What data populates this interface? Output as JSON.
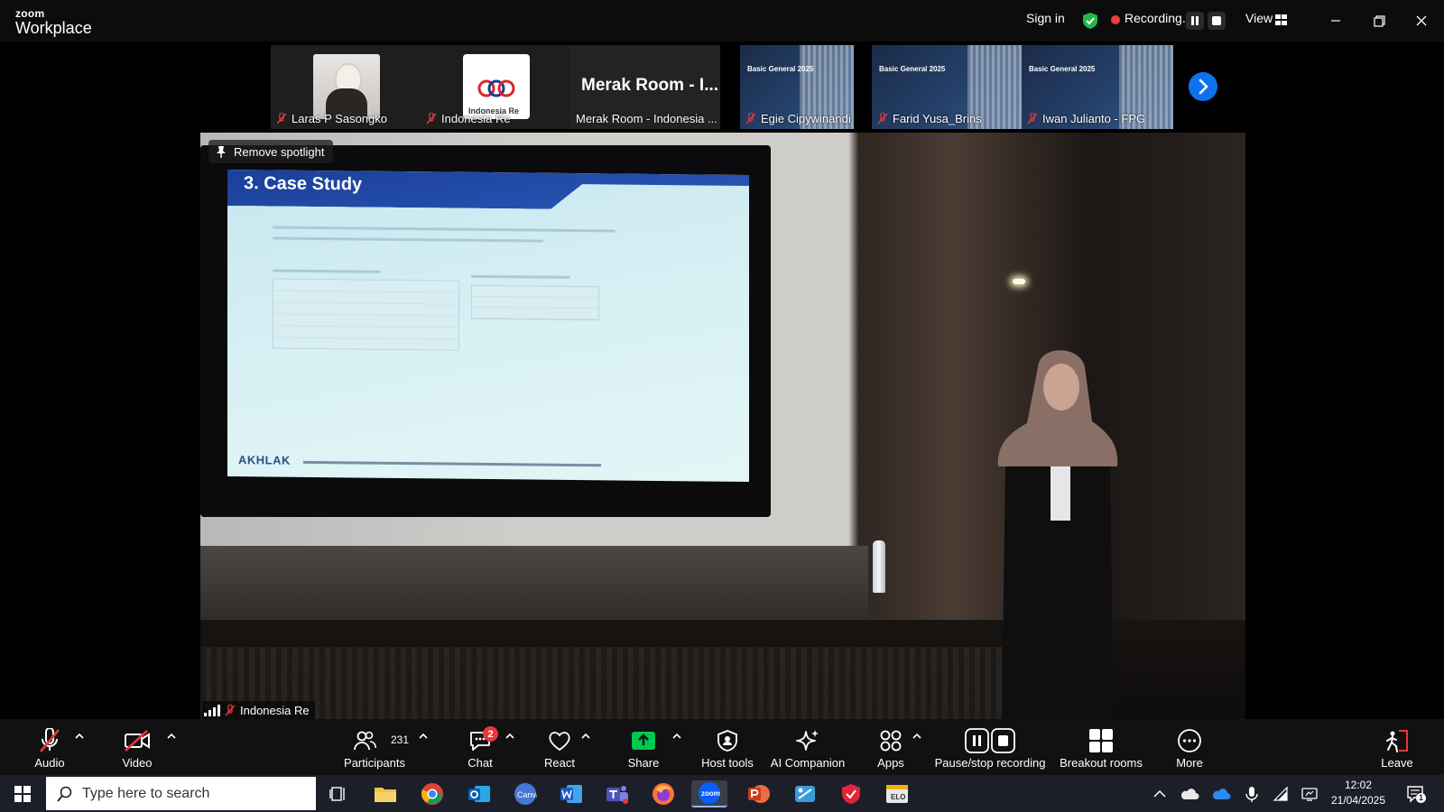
{
  "app": {
    "brand_small": "zoom",
    "brand_name": "Workplace"
  },
  "titlebar": {
    "sign_in": "Sign in",
    "recording": "Recording...",
    "view": "View"
  },
  "gallery": {
    "tiles": [
      {
        "name": "Laras P Sasongko"
      },
      {
        "name": "Indonesia Re",
        "logo_text": "Indonesia Re"
      },
      {
        "name": "Merak Room - Indonesia ...",
        "big_text": "Merak Room - I..."
      },
      {
        "name": "Egie Cipywinandi",
        "slide_title": "Basic General 2025"
      },
      {
        "name": "Farid Yusa_Brins",
        "slide_title": "Basic General 2025"
      },
      {
        "name": "Iwan Julianto - FPG",
        "slide_title": "Basic General 2025"
      }
    ]
  },
  "main_video": {
    "remove_spotlight": "Remove spotlight",
    "name": "Indonesia Re",
    "slide_title": "3. Case Study",
    "slide_footer": "AKHLAK"
  },
  "toolbar": {
    "audio": "Audio",
    "video": "Video",
    "participants": "Participants",
    "participants_count": "231",
    "chat": "Chat",
    "chat_badge": "2",
    "react": "React",
    "share": "Share",
    "host_tools": "Host tools",
    "ai_companion": "AI Companion",
    "apps": "Apps",
    "pause_stop": "Pause/stop recording",
    "breakout": "Breakout rooms",
    "more": "More",
    "leave": "Leave"
  },
  "taskbar": {
    "search_placeholder": "Type here to search",
    "time": "12:02",
    "date": "21/04/2025",
    "notif_count": "1"
  },
  "colors": {
    "accent": "#0e72ed",
    "share_green": "#00c850",
    "mute_red": "#e6383e",
    "recording_red": "#e9423a",
    "shield_green": "#20b84a"
  }
}
